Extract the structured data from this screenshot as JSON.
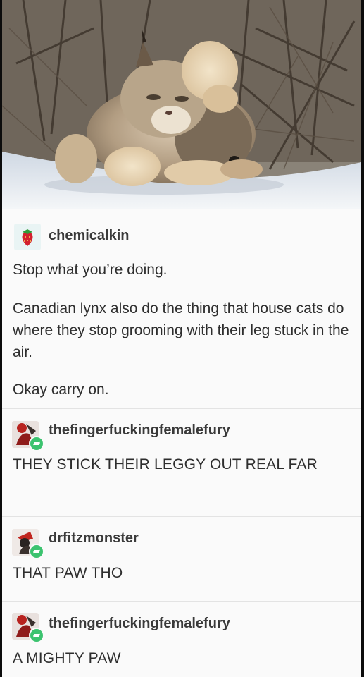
{
  "photo": {
    "icon": "lynx-photo"
  },
  "posts": [
    {
      "username": "chemicalkin",
      "avatar_icon": "strawberry-icon",
      "paragraphs": [
        "Stop what you’re doing.",
        "Canadian lynx also do the thing that house cats do where they stop grooming with their leg stuck in the air.",
        "Okay carry on."
      ]
    },
    {
      "username": "thefingerfuckingfemalefury",
      "avatar_icon": "red-figure-avatar-icon",
      "reblog_icon": "reblog-icon",
      "text": "THEY STICK THEIR LEGGY OUT REAL FAR"
    },
    {
      "username": "drfitzmonster",
      "avatar_icon": "dark-figure-avatar-icon",
      "reblog_icon": "reblog-icon",
      "text": "THAT PAW THO"
    },
    {
      "username": "thefingerfuckingfemalefury",
      "avatar_icon": "red-figure-avatar-icon",
      "reblog_icon": "reblog-icon",
      "text": "A MIGHTY PAW"
    }
  ],
  "colors": {
    "card_bg": "#fafafa",
    "divider": "#e3e3e3",
    "reblog_green": "#3cc36f",
    "text": "#2e2e2e"
  }
}
